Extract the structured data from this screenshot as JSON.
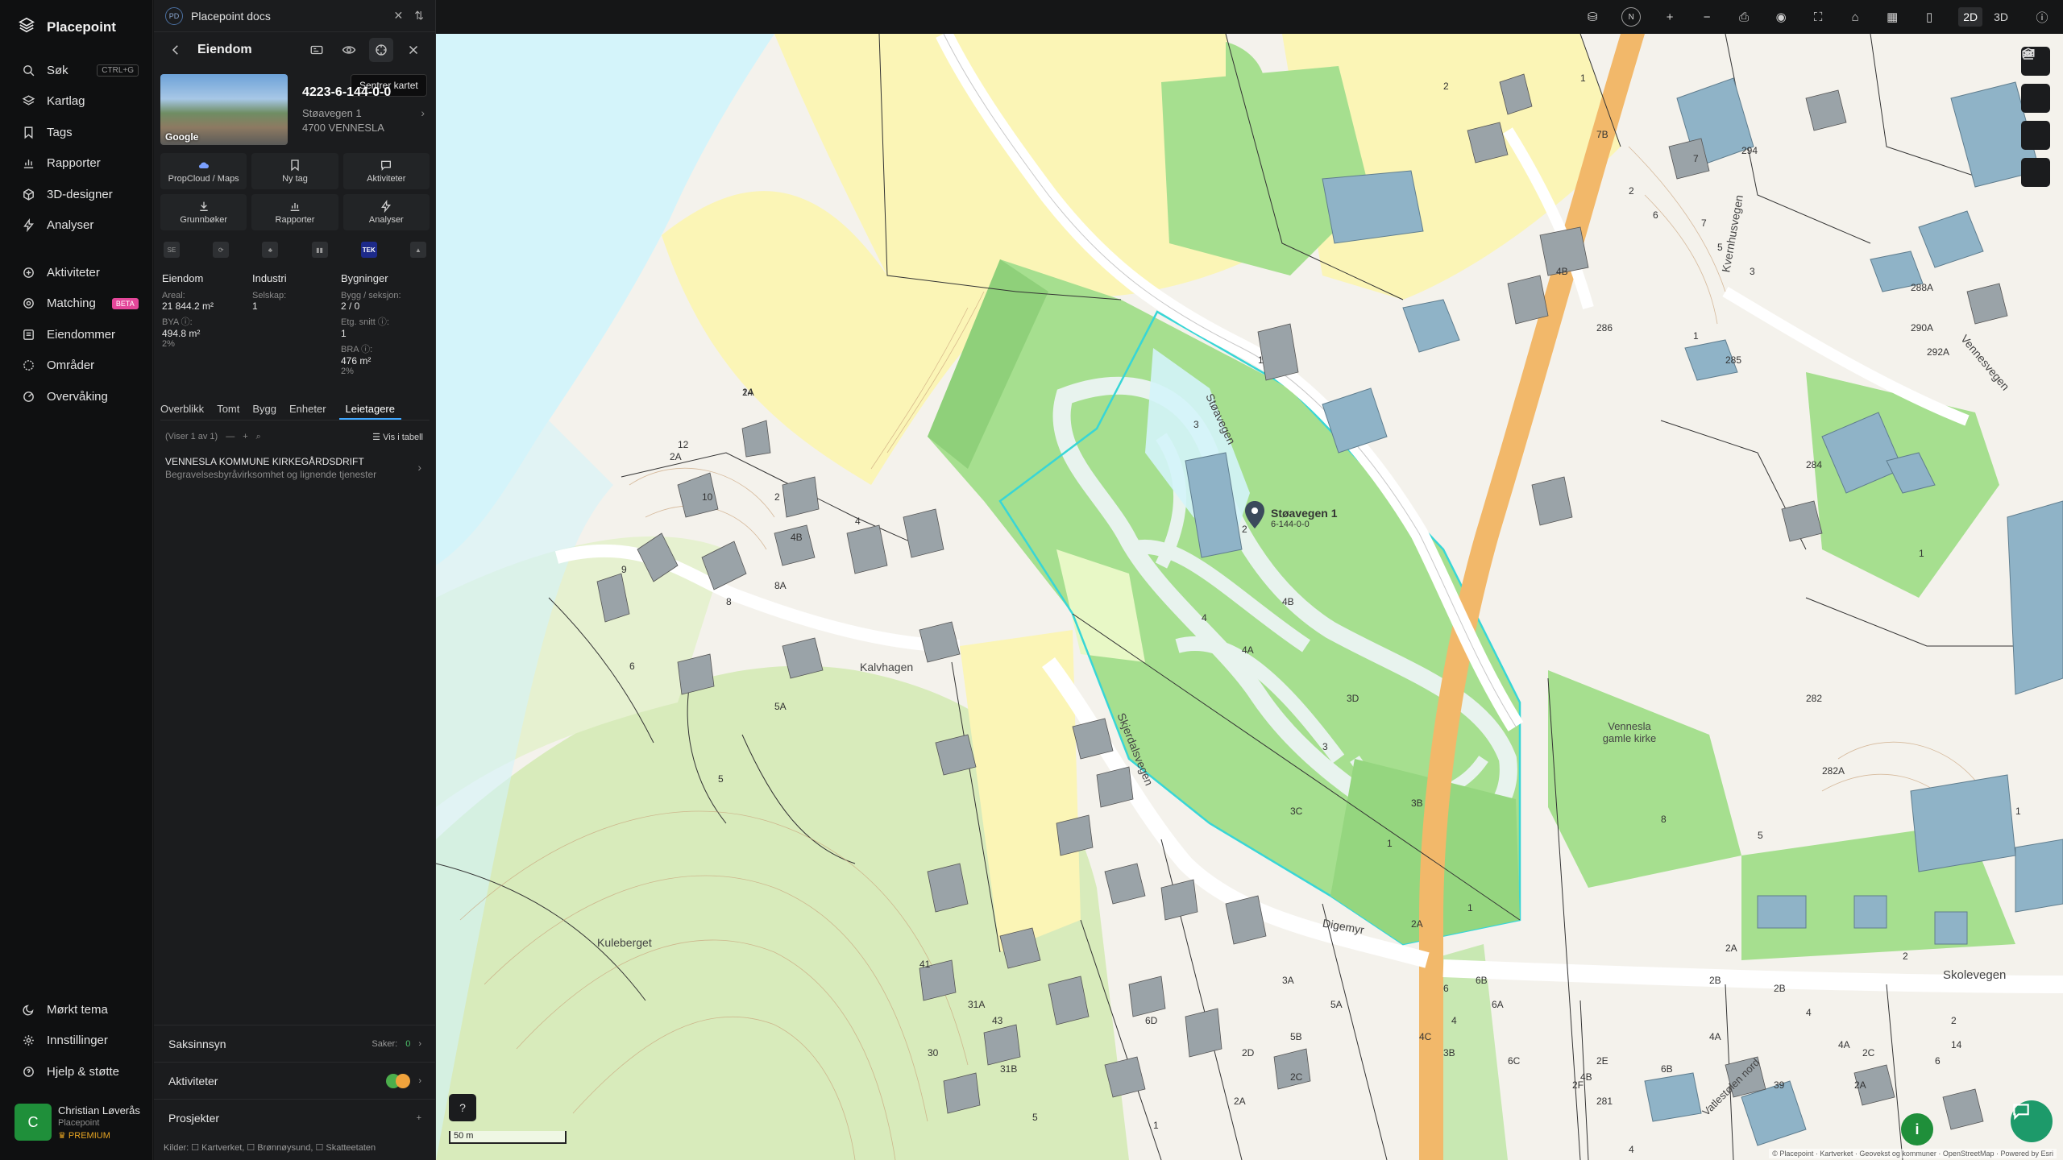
{
  "app": {
    "name": "Placepoint"
  },
  "nav": {
    "items": [
      {
        "label": "Søk",
        "icon": "search-icon",
        "kbd": "CTRL+G"
      },
      {
        "label": "Kartlag",
        "icon": "layers-icon"
      },
      {
        "label": "Tags",
        "icon": "bookmark-icon"
      },
      {
        "label": "Rapporter",
        "icon": "bar-chart-icon"
      },
      {
        "label": "3D-designer",
        "icon": "cube-icon"
      },
      {
        "label": "Analyser",
        "icon": "bolt-icon"
      }
    ],
    "items2": [
      {
        "label": "Aktiviteter",
        "icon": "activity-icon"
      },
      {
        "label": "Matching",
        "icon": "target-icon",
        "badge": "BETA"
      },
      {
        "label": "Eiendommer",
        "icon": "building-list-icon"
      },
      {
        "label": "Områder",
        "icon": "area-icon"
      },
      {
        "label": "Overvåking",
        "icon": "radar-icon"
      }
    ],
    "bottom": [
      {
        "label": "Mørkt tema",
        "icon": "moon-icon"
      },
      {
        "label": "Innstillinger",
        "icon": "gear-icon"
      },
      {
        "label": "Hjelp & støtte",
        "icon": "help-icon"
      }
    ],
    "user": {
      "initial": "C",
      "name": "Christian Løverås",
      "org": "Placepoint",
      "tier": "PREMIUM"
    }
  },
  "panel": {
    "doc_badge": "PD",
    "doc_title": "Placepoint docs",
    "title": "Eiendom",
    "tooltip": "Sentrer kartet",
    "property": {
      "id": "4223-6-144-0-0",
      "address": "Støavegen 1",
      "postal": "4700 VENNESLA",
      "thumb_label": "Google"
    },
    "buttons": [
      {
        "label": "PropCloud / Maps",
        "icon": "cloud-icon"
      },
      {
        "label": "Ny tag",
        "icon": "bookmark-icon"
      },
      {
        "label": "Aktiviteter",
        "icon": "chat-icon"
      },
      {
        "label": "Grunnbøker",
        "icon": "download-icon"
      },
      {
        "label": "Rapporter",
        "icon": "bar-chart-icon"
      },
      {
        "label": "Analyser",
        "icon": "bolt-icon"
      }
    ],
    "sources": [
      {
        "label": "SE"
      },
      {
        "label": "⟳"
      },
      {
        "label": "♣"
      },
      {
        "label": "▮▮"
      },
      {
        "label": "TEK"
      },
      {
        "label": "▲"
      }
    ],
    "stats": {
      "col1": {
        "title": "Eiendom",
        "areal_label": "Areal:",
        "areal": "21 844.2 m²",
        "bya_label": "BYA ⓘ:",
        "bya": "494.8 m²",
        "bya_pct": "2%"
      },
      "col2": {
        "title": "Industri",
        "selskap_label": "Selskap:",
        "selskap": "1"
      },
      "col3": {
        "title": "Bygninger",
        "bygg_label": "Bygg / seksjon:",
        "bygg": "2 / 0",
        "etg_label": "Etg. snitt ⓘ:",
        "etg": "1",
        "bra_label": "BRA ⓘ:",
        "bra": "476 m²",
        "bra_pct": "2%"
      }
    },
    "tabs": [
      "Overblikk",
      "Tomt",
      "Bygg",
      "Enheter",
      "Leietagere"
    ],
    "active_tab": "Leietagere",
    "list_info": "(Viser 1 av 1)",
    "list_table": "Vis i tabell",
    "tenant": {
      "name": "VENNESLA KOMMUNE KIRKEGÅRDSDRIFT",
      "desc": "Begravelsesbyråvirksomhet og lignende tjenester"
    },
    "saksinnsyn": {
      "label": "Saksinnsyn",
      "count_label": "Saker:",
      "count": "0"
    },
    "aktiviteter": {
      "label": "Aktiviteter"
    },
    "prosjekter": {
      "label": "Prosjekter"
    },
    "sources_line": "Kilder: ☐ Kartverket, ☐ Brønnøysund, ☐ Skatteetaten"
  },
  "topbar": {
    "compass": "N",
    "view_2d": "2D",
    "view_3d": "3D"
  },
  "map": {
    "labels": [
      {
        "text": "Støavegen"
      },
      {
        "text": "Skjerdalsvegen"
      },
      {
        "text": "Vennesla gamle kirke"
      },
      {
        "text": "Kvernhusvegen"
      },
      {
        "text": "Vennesvegen"
      },
      {
        "text": "Kalvhagen"
      },
      {
        "text": "Kuleberget"
      },
      {
        "text": "Digemyr"
      },
      {
        "text": "Skolevegen"
      },
      {
        "text": "Vatlestølen nord"
      }
    ],
    "house_numbers": [
      "14",
      "12",
      "10",
      "9",
      "8",
      "8A",
      "4B",
      "4",
      "2",
      "2A",
      "6",
      "5A",
      "5",
      "3D",
      "3",
      "3B",
      "3C",
      "1",
      "2A",
      "4A",
      "4",
      "4B",
      "2",
      "3",
      "1",
      "286",
      "284",
      "288A",
      "290A",
      "292A",
      "285",
      "294",
      "7B",
      "7",
      "5",
      "3",
      "1",
      "1",
      "282",
      "282A",
      "5",
      "1",
      "2",
      "2A",
      "2B",
      "2C",
      "6",
      "6B",
      "4",
      "4A",
      "4B",
      "4C",
      "6A",
      "6B",
      "6C",
      "3B",
      "3A",
      "5A",
      "5B",
      "2D",
      "2A",
      "2C",
      "2E",
      "2F",
      "281",
      "39",
      "41",
      "43",
      "31B",
      "31A",
      "30",
      "5",
      "6D",
      "1",
      "4",
      "6",
      "2",
      "1",
      "2",
      "4B",
      "6",
      "7",
      "14",
      "2",
      "4",
      "4A",
      "2A",
      "2B",
      "1",
      "8",
      "2A"
    ],
    "pin_label": "Støavegen 1",
    "pin_sublabel": "6-144-0-0",
    "scale": "50 m",
    "attribution": "© Placepoint · Kartverket · Geovekst og kommuner · OpenStreetMap · Powered by Esri"
  },
  "colors": {
    "accent": "#3fa7ff",
    "green_zone": "#a6df8f",
    "yellow_zone": "#fbf5b6",
    "water": "#d4f4fa",
    "building": "#8fb3c7",
    "road": "#f2b86a",
    "parcel_highlight": "#38d6d6",
    "forest": "#d6e9b5"
  }
}
